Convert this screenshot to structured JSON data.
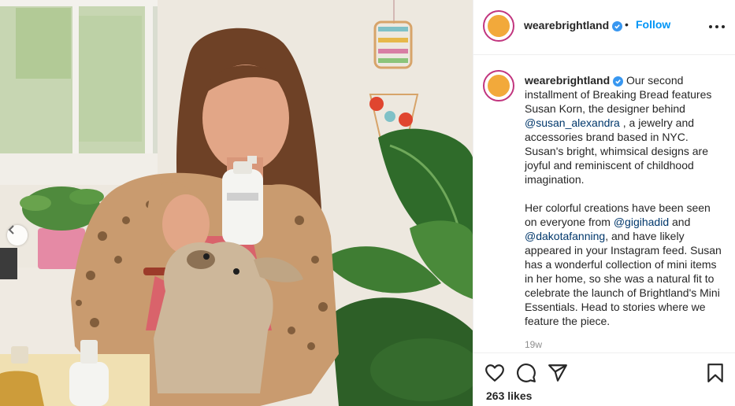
{
  "account": {
    "username": "wearebrightland",
    "verified": true,
    "follow_label": "Follow",
    "separator": "•"
  },
  "caption": {
    "author": "wearebrightland",
    "p1_a": " Our second installment of Breaking Bread features Susan Korn, the designer behind ",
    "mention_1": "@susan_alexandra",
    "p1_b": " , a jewelry and accessories brand based in NYC. Susan's bright, whimsical designs are joyful and reminiscent of childhood imagination.",
    "p2_a": "Her colorful creations have been seen on everyone from ",
    "mention_2": "@gigihadid",
    "p2_b": " and ",
    "mention_3": "@dakotafanning",
    "p2_c": ", and have likely appeared in your Instagram feed. Susan has a wonderful collection of mini items in her home, so she was a natural fit to celebrate the launch of Brightland's Mini Essentials. Head to stories where we feature the piece."
  },
  "timestamp": "19w",
  "likes": "263 likes",
  "icons": {
    "like": "heart-icon",
    "comment": "comment-icon",
    "share": "paper-plane-icon",
    "save": "bookmark-icon",
    "more": "more-options-icon",
    "carousel_prev": "chevron-left-icon"
  },
  "colors": {
    "follow": "#0095f6",
    "verified": "#3897f0",
    "mention": "#00376b",
    "avatar_ring": "#c1357e",
    "avatar_fill": "#f2a93b",
    "muted": "#8e8e8e"
  }
}
